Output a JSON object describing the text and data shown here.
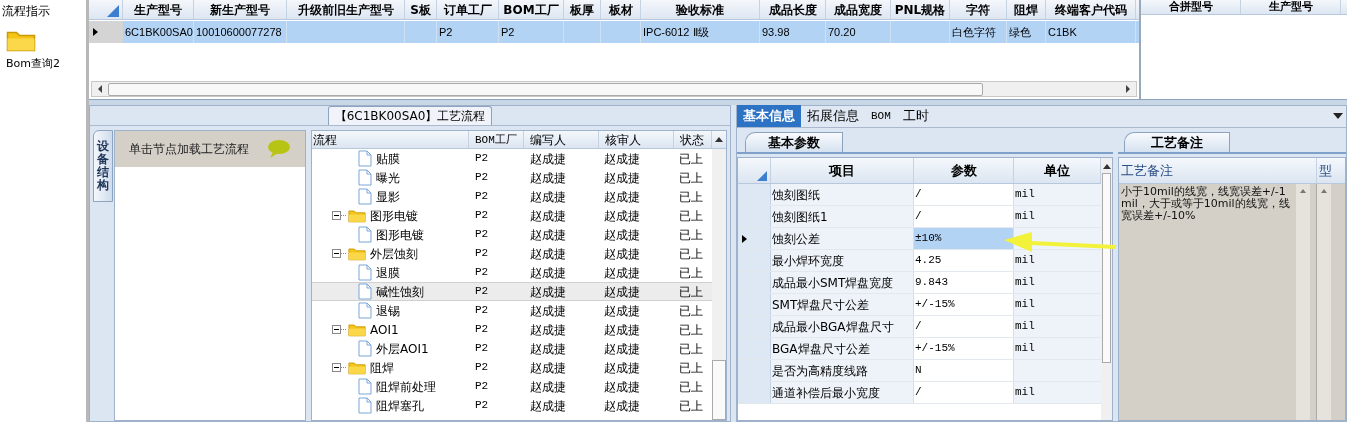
{
  "desktop": {
    "caption": "流程指示",
    "icons": [
      {
        "label": "Bom查询2"
      }
    ]
  },
  "top_grid": {
    "columns": [
      "生产型号",
      "新生产型号",
      "升级前旧生产型号",
      "S板",
      "订单工厂",
      "BOM工厂",
      "板厚",
      "板材",
      "验收标准",
      "成品长度",
      "成品宽度",
      "PNL规格",
      "字符",
      "阻焊",
      "终端客户代码"
    ],
    "rows": [
      {
        "selected": true,
        "cells": [
          "6C1BK00SA0",
          "10010600077278",
          null,
          null,
          "P2",
          "P2",
          null,
          null,
          "IPC-6012 Ⅱ级",
          "93.98",
          "70.20",
          null,
          "白色字符",
          "绿色",
          "C1BK"
        ]
      }
    ]
  },
  "side_grid": {
    "columns": [
      "合拼型号",
      "生产型号"
    ]
  },
  "flow_panel": {
    "title": "【6C1BK00SA0】工艺流程",
    "side_tab": "设备结构",
    "hint": "单击节点加载工艺流程",
    "columns": [
      "流程",
      "BOM工厂",
      "编写人",
      "核审人",
      "状态"
    ],
    "nodes": [
      {
        "kind": "step",
        "name": "贴膜",
        "factory": "P2",
        "author": "赵成捷",
        "reviewer": "赵成捷",
        "status": "已上",
        "selected": false
      },
      {
        "kind": "step",
        "name": "曝光",
        "factory": "P2",
        "author": "赵成捷",
        "reviewer": "赵成捷",
        "status": "已上",
        "selected": false
      },
      {
        "kind": "step",
        "name": "显影",
        "factory": "P2",
        "author": "赵成捷",
        "reviewer": "赵成捷",
        "status": "已上",
        "selected": false
      },
      {
        "kind": "group",
        "name": "图形电镀",
        "factory": "P2",
        "author": "赵成捷",
        "reviewer": "赵成捷",
        "status": "已上",
        "selected": false,
        "expanded": true,
        "children": [
          {
            "kind": "step",
            "name": "图形电镀",
            "factory": "P2",
            "author": "赵成捷",
            "reviewer": "赵成捷",
            "status": "已上",
            "selected": false
          }
        ]
      },
      {
        "kind": "group",
        "name": "外层蚀刻",
        "factory": "P2",
        "author": "赵成捷",
        "reviewer": "赵成捷",
        "status": "已上",
        "selected": false,
        "expanded": true,
        "children": [
          {
            "kind": "step",
            "name": "退膜",
            "factory": "P2",
            "author": "赵成捷",
            "reviewer": "赵成捷",
            "status": "已上",
            "selected": false
          },
          {
            "kind": "step",
            "name": "碱性蚀刻",
            "factory": "P2",
            "author": "赵成捷",
            "reviewer": "赵成捷",
            "status": "已上",
            "selected": true
          },
          {
            "kind": "step",
            "name": "退锡",
            "factory": "P2",
            "author": "赵成捷",
            "reviewer": "赵成捷",
            "status": "已上",
            "selected": false
          }
        ]
      },
      {
        "kind": "group",
        "name": "AOI1",
        "factory": "P2",
        "author": "赵成捷",
        "reviewer": "赵成捷",
        "status": "已上",
        "selected": false,
        "expanded": true,
        "children": [
          {
            "kind": "step",
            "name": "外层AOI1",
            "factory": "P2",
            "author": "赵成捷",
            "reviewer": "赵成捷",
            "status": "已上",
            "selected": false
          }
        ]
      },
      {
        "kind": "group",
        "name": "阻焊",
        "factory": "P2",
        "author": "赵成捷",
        "reviewer": "赵成捷",
        "status": "已上",
        "selected": false,
        "expanded": true,
        "children": [
          {
            "kind": "step",
            "name": "阻焊前处理",
            "factory": "P2",
            "author": "赵成捷",
            "reviewer": "赵成捷",
            "status": "已上",
            "selected": false
          },
          {
            "kind": "step",
            "name": "阻焊塞孔",
            "factory": "P2",
            "author": "赵成捷",
            "reviewer": "赵成捷",
            "status": "已上",
            "selected": false
          }
        ]
      }
    ]
  },
  "info_panel": {
    "tabs": [
      {
        "label": "基本信息",
        "selected": true
      },
      {
        "label": "拓展信息",
        "selected": false
      },
      {
        "label": "BOM",
        "selected": false
      },
      {
        "label": "工时",
        "selected": false
      }
    ],
    "params_tab": "基本参数",
    "columns": [
      "项目",
      "参数",
      "单位"
    ],
    "params": [
      {
        "item": "蚀刻图纸",
        "value": "/",
        "unit": "mil",
        "selected": false
      },
      {
        "item": "蚀刻图纸1",
        "value": "/",
        "unit": "mil",
        "selected": false
      },
      {
        "item": "蚀刻公差",
        "value": "±10%",
        "selected": true
      },
      {
        "item": "最小焊环宽度",
        "value": "4.25",
        "unit": "mil",
        "selected": false
      },
      {
        "item": "成品最小SMT焊盘宽度",
        "value": "9.843",
        "unit": "mil",
        "selected": false
      },
      {
        "item": "SMT焊盘尺寸公差",
        "value": "+/-15%",
        "unit": "mil",
        "selected": false
      },
      {
        "item": "成品最小BGA焊盘尺寸",
        "value": "/",
        "unit": "mil",
        "selected": false
      },
      {
        "item": "BGA焊盘尺寸公差",
        "value": "+/-15%",
        "unit": "mil",
        "selected": false
      },
      {
        "item": "是否为高精度线路",
        "value": "N",
        "selected": false
      },
      {
        "item": "通道补偿后最小宽度",
        "value": "/",
        "unit": "mil",
        "selected": false
      }
    ],
    "notes_tab": "工艺备注",
    "notes_columns": [
      "工艺备注",
      "型"
    ],
    "note": "小于10mil的线宽，线宽误差+/-1mil，大于或等于10mil的线宽，线宽误差+/-10%"
  }
}
